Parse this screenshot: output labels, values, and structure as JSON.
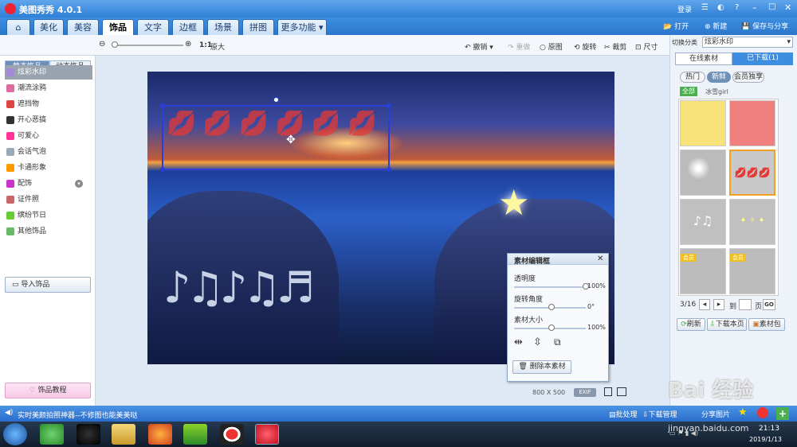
{
  "app": {
    "title": "美图秀秀 4.0.1",
    "login": "登录",
    "new_label": "新建",
    "save_label": "保存与分享",
    "open_label": "打开"
  },
  "tabs": [
    {
      "label": "美化"
    },
    {
      "label": "美容"
    },
    {
      "label": "饰品"
    },
    {
      "label": "文字"
    },
    {
      "label": "边框"
    },
    {
      "label": "场景"
    },
    {
      "label": "拼图"
    },
    {
      "label": "更多功能"
    }
  ],
  "toolbar": {
    "zoom_ratio": "1:1",
    "original_size": "原大",
    "undo": "撤销",
    "redo": "重做",
    "restore": "原图",
    "rotate": "旋转",
    "crop": "裁剪",
    "resize": "尺寸"
  },
  "left": {
    "subtab_static": "静态饰品",
    "subtab_dynamic": "动态饰品",
    "categories": [
      {
        "label": "炫彩水印",
        "color": "#a48ad6"
      },
      {
        "label": "潮流涂鸦",
        "color": "#e36aa0"
      },
      {
        "label": "遮挡物",
        "color": "#d44"
      },
      {
        "label": "开心恶搞",
        "color": "#333"
      },
      {
        "label": "可爱心",
        "color": "#f39"
      },
      {
        "label": "会话气泡",
        "color": "#9ab"
      },
      {
        "label": "卡通形象",
        "color": "#f90"
      },
      {
        "label": "配饰",
        "color": "#c3c"
      },
      {
        "label": "证件照",
        "color": "#c66"
      },
      {
        "label": "缤纷节日",
        "color": "#6c3"
      },
      {
        "label": "其他饰品",
        "color": "#6b6"
      }
    ],
    "import": "导入饰品",
    "tutorial": "饰品教程"
  },
  "editor": {
    "title": "素材编辑框",
    "opacity_label": "透明度",
    "opacity_value": "100%",
    "rotation_label": "旋转角度",
    "rotation_value": "0°",
    "size_label": "素材大小",
    "size_value": "100%",
    "delete": "删除本素材",
    "opacity_fraction": 1.0,
    "rotation_fraction": 0.5,
    "size_fraction": 0.5
  },
  "canvas_info": {
    "width": "800",
    "times": "X",
    "height": "500",
    "exif": "EXIF"
  },
  "right": {
    "switch_label": "切换分类",
    "category": "炫彩水印",
    "tab_online": "在线素材",
    "tab_downloaded": "已下载(1)",
    "filters": [
      "热门",
      "新鲜",
      "会员独享"
    ],
    "all": "全部",
    "author": "冰雪girl",
    "page": "3/16",
    "goto": "到",
    "page_unit": "页",
    "go": "GO",
    "refresh": "刷新",
    "download_page": "下载本页",
    "pack": "素材包",
    "vip": "会员"
  },
  "status": {
    "tip": "实时美颜拍照神器--不修图也能美美哒",
    "batch": "批处理",
    "download_mgr": "下载管理",
    "share": "分享图片"
  },
  "taskbar": {
    "time": "21:13",
    "date": "2019/1/13"
  },
  "watermark": {
    "site": "jingyan.baidu.com",
    "brand": "Bai 经验"
  }
}
